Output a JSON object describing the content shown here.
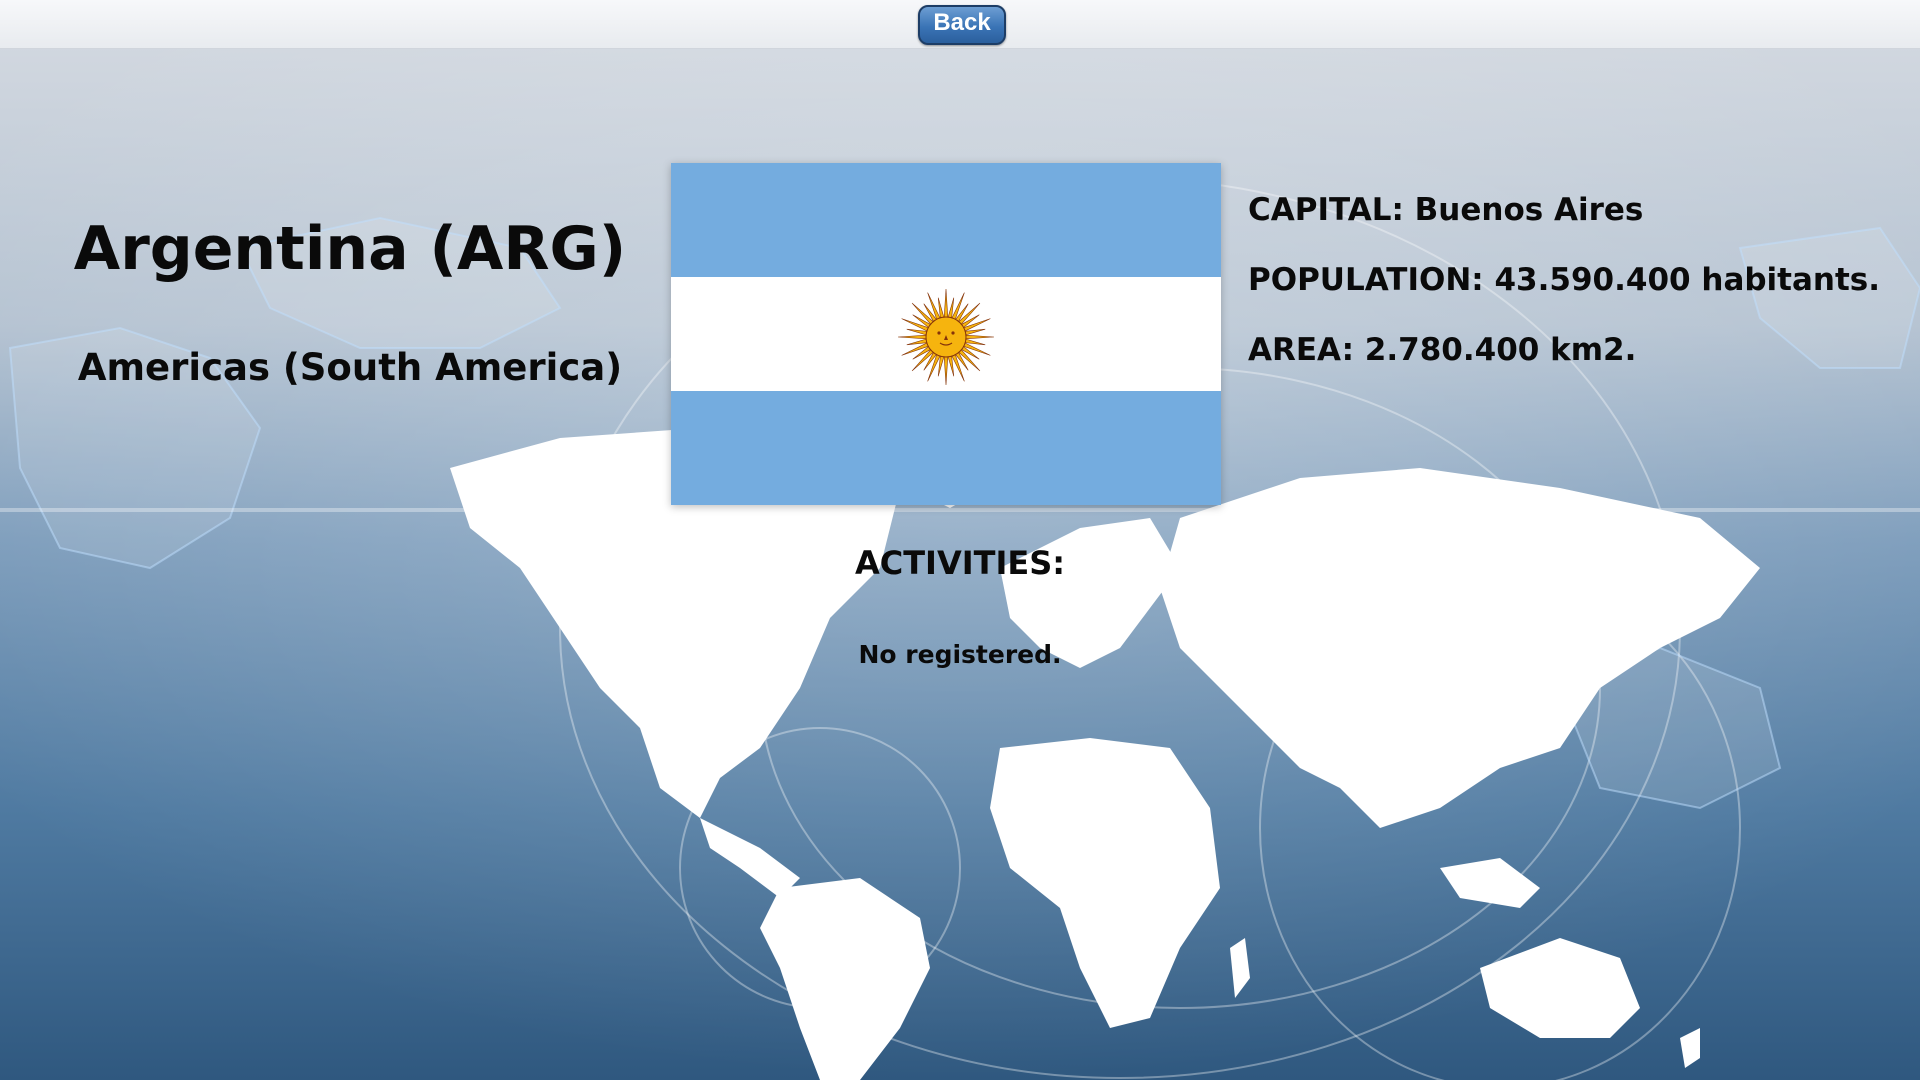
{
  "header": {
    "back_label": "Back"
  },
  "country": {
    "title": "Argentina (ARG)",
    "region": "Americas (South America)"
  },
  "facts": {
    "capital": "CAPITAL: Buenos Aires",
    "population": "POPULATION: 43.590.400 habitants.",
    "area": "AREA: 2.780.400 km2."
  },
  "activities": {
    "title": "ACTIVITIES:",
    "text": "No registered."
  },
  "flag": {
    "name": "argentina-flag",
    "colors": {
      "blue": "#74acdf",
      "white": "#ffffff",
      "sun": "#f6b40e",
      "sun_outline": "#85340a"
    }
  },
  "colors": {
    "button_blue": "#3a74b6",
    "background_top": "#d6dbe2",
    "background_bottom": "#2f587f"
  }
}
